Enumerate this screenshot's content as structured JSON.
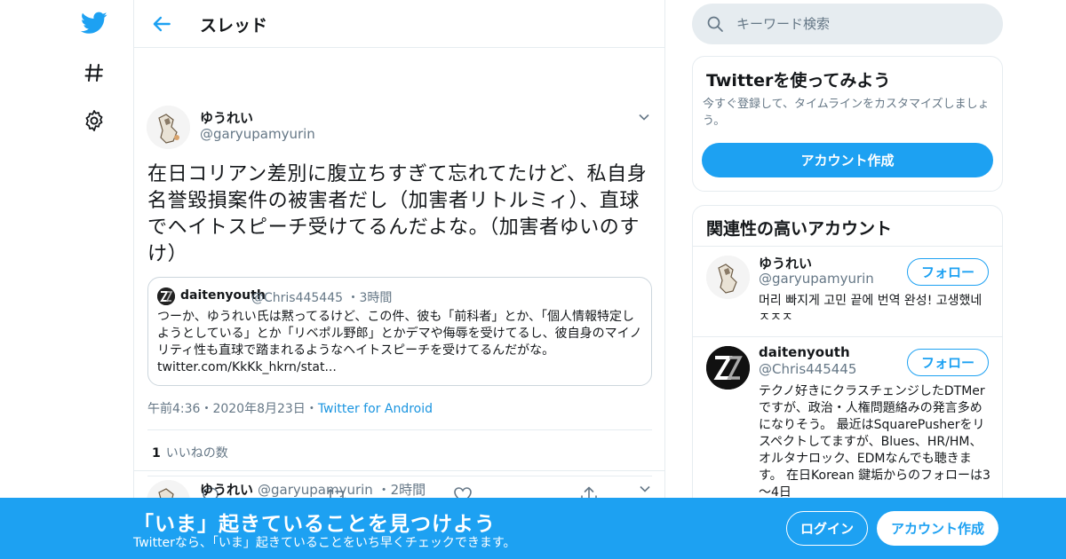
{
  "colors": {
    "accent": "#1da1f2",
    "text": "#14171a",
    "muted": "#657786",
    "border": "#e6ecf0"
  },
  "nav": {
    "icons": [
      "twitter-bird-icon",
      "hashtag-icon",
      "gear-icon"
    ]
  },
  "header": {
    "title": "スレッド"
  },
  "tweet": {
    "name": "ゆうれい",
    "handle": "@garyupamyurin",
    "text": "在日コリアン差別に腹立ちすぎて忘れてたけど、私自身名誉毀損案件の被害者だし（加害者リトルミィ）、直球でヘイトスピーチ受けてるんだよな。（加害者ゆいのすけ）",
    "quote": {
      "name": "daitenyouth",
      "handle": "@Chris445445",
      "sep": "・",
      "time": "3時間",
      "text": "つーか、ゆうれい氏は黙ってるけど、この件、彼も「前科者」とか、「個人情報特定しようとしている」とか「リベポル野郎」とかデマや侮辱を受けてるし、彼自身のマイノリティ性も直球で踏まれるようなヘイトスピーチを受けてるんだがな。",
      "link": "twitter.com/KkKk_hkrn/stat..."
    },
    "time": "午前4:36",
    "date": "2020年8月23日",
    "sep": "・",
    "source": "Twitter for Android",
    "likes_count": "1",
    "likes_label": "いいねの数"
  },
  "reply": {
    "name": "ゆうれい",
    "handle": "@garyupamyurin",
    "sep": "・",
    "time": "2時間"
  },
  "search": {
    "placeholder": "キーワード検索"
  },
  "signup_card": {
    "title": "Twitterを使ってみよう",
    "subtitle": "今すぐ登録して、タイムラインをカスタマイズしましょう。",
    "button": "アカウント作成"
  },
  "related": {
    "title": "関連性の高いアカウント",
    "accounts": [
      {
        "name": "ゆうれい",
        "handle": "@garyupamyurin",
        "follow": "フォロー",
        "bio": "머리 빠지게 고민 끝에 번역 완성! 고생했네 ㅈㅈㅈ"
      },
      {
        "name": "daitenyouth",
        "handle": "@Chris445445",
        "follow": "フォロー",
        "bio": "テクノ好きにクラスチェンジしたDTMerですが、政治・人権問題絡みの発言多めになりそう。 最近はSquarePusherをリスペクトしてますが、Blues、HR/HM、オルタナロック、EDMなんでも聴きます。 在日Korean 鍵垢からのフォローは3～4日"
      }
    ]
  },
  "banner": {
    "title": "「いま」起きていることを見つけよう",
    "subtitle": "Twitterなら、「いま」起きていることをいち早くチェックできます。",
    "login": "ログイン",
    "signup": "アカウント作成"
  }
}
